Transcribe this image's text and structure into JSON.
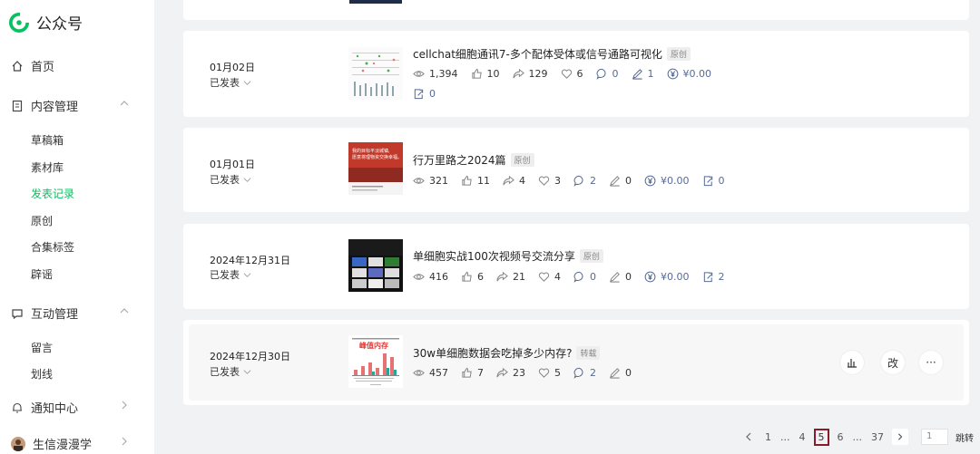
{
  "app": {
    "name": "公众号"
  },
  "sidebar": {
    "home": "首页",
    "content_mgmt": "内容管理",
    "content_items": [
      "草稿箱",
      "素材库",
      "发表记录",
      "原创",
      "合集标签",
      "辟谣"
    ],
    "interact_mgmt": "互动管理",
    "interact_items": [
      "留言",
      "划线"
    ],
    "notifications": "通知中心",
    "account": "生信漫漫学"
  },
  "posts": [
    {
      "date": "01月02日",
      "status": "已发表",
      "title": "cellchat细胞通讯7-多个配体受体或信号通路可视化",
      "badge": "原创",
      "reads": "1,394",
      "likes": "10",
      "shares": "129",
      "favs": "6",
      "comments": "0",
      "notes": "1",
      "reward": "¥0.00",
      "saves": "0"
    },
    {
      "date": "01月01日",
      "status": "已发表",
      "title": "行万里路之2024篇",
      "badge": "原创",
      "reads": "321",
      "likes": "11",
      "shares": "4",
      "favs": "3",
      "comments": "2",
      "notes": "0",
      "reward": "¥0.00",
      "saves": "0"
    },
    {
      "date": "2024年12月31日",
      "status": "已发表",
      "title": "单细胞实战100次视频号交流分享",
      "badge": "原创",
      "reads": "416",
      "likes": "6",
      "shares": "21",
      "favs": "4",
      "comments": "0",
      "notes": "0",
      "reward": "¥0.00",
      "saves": "2"
    },
    {
      "date": "2024年12月30日",
      "status": "已发表",
      "title": "30w单细胞数据会吃掉多少内存?",
      "badge": "转载",
      "reads": "457",
      "likes": "7",
      "shares": "23",
      "favs": "5",
      "comments": "2",
      "notes": "0",
      "thumb_text": "峰值内存"
    }
  ],
  "thumb2_lines": [
    "我的目标平淡城镇,",
    "愿意将理物资交换幸福。"
  ],
  "actions": {
    "edit": "改",
    "more": "···"
  },
  "pagination": {
    "pages": [
      "1",
      "...",
      "4",
      "5",
      "6",
      "...",
      "37"
    ],
    "current": "5",
    "input_value": "1",
    "go": "跳转"
  },
  "colors": {
    "accent": "#07c160",
    "link": "#576b95",
    "current_page_border": "#8b1a2b"
  }
}
